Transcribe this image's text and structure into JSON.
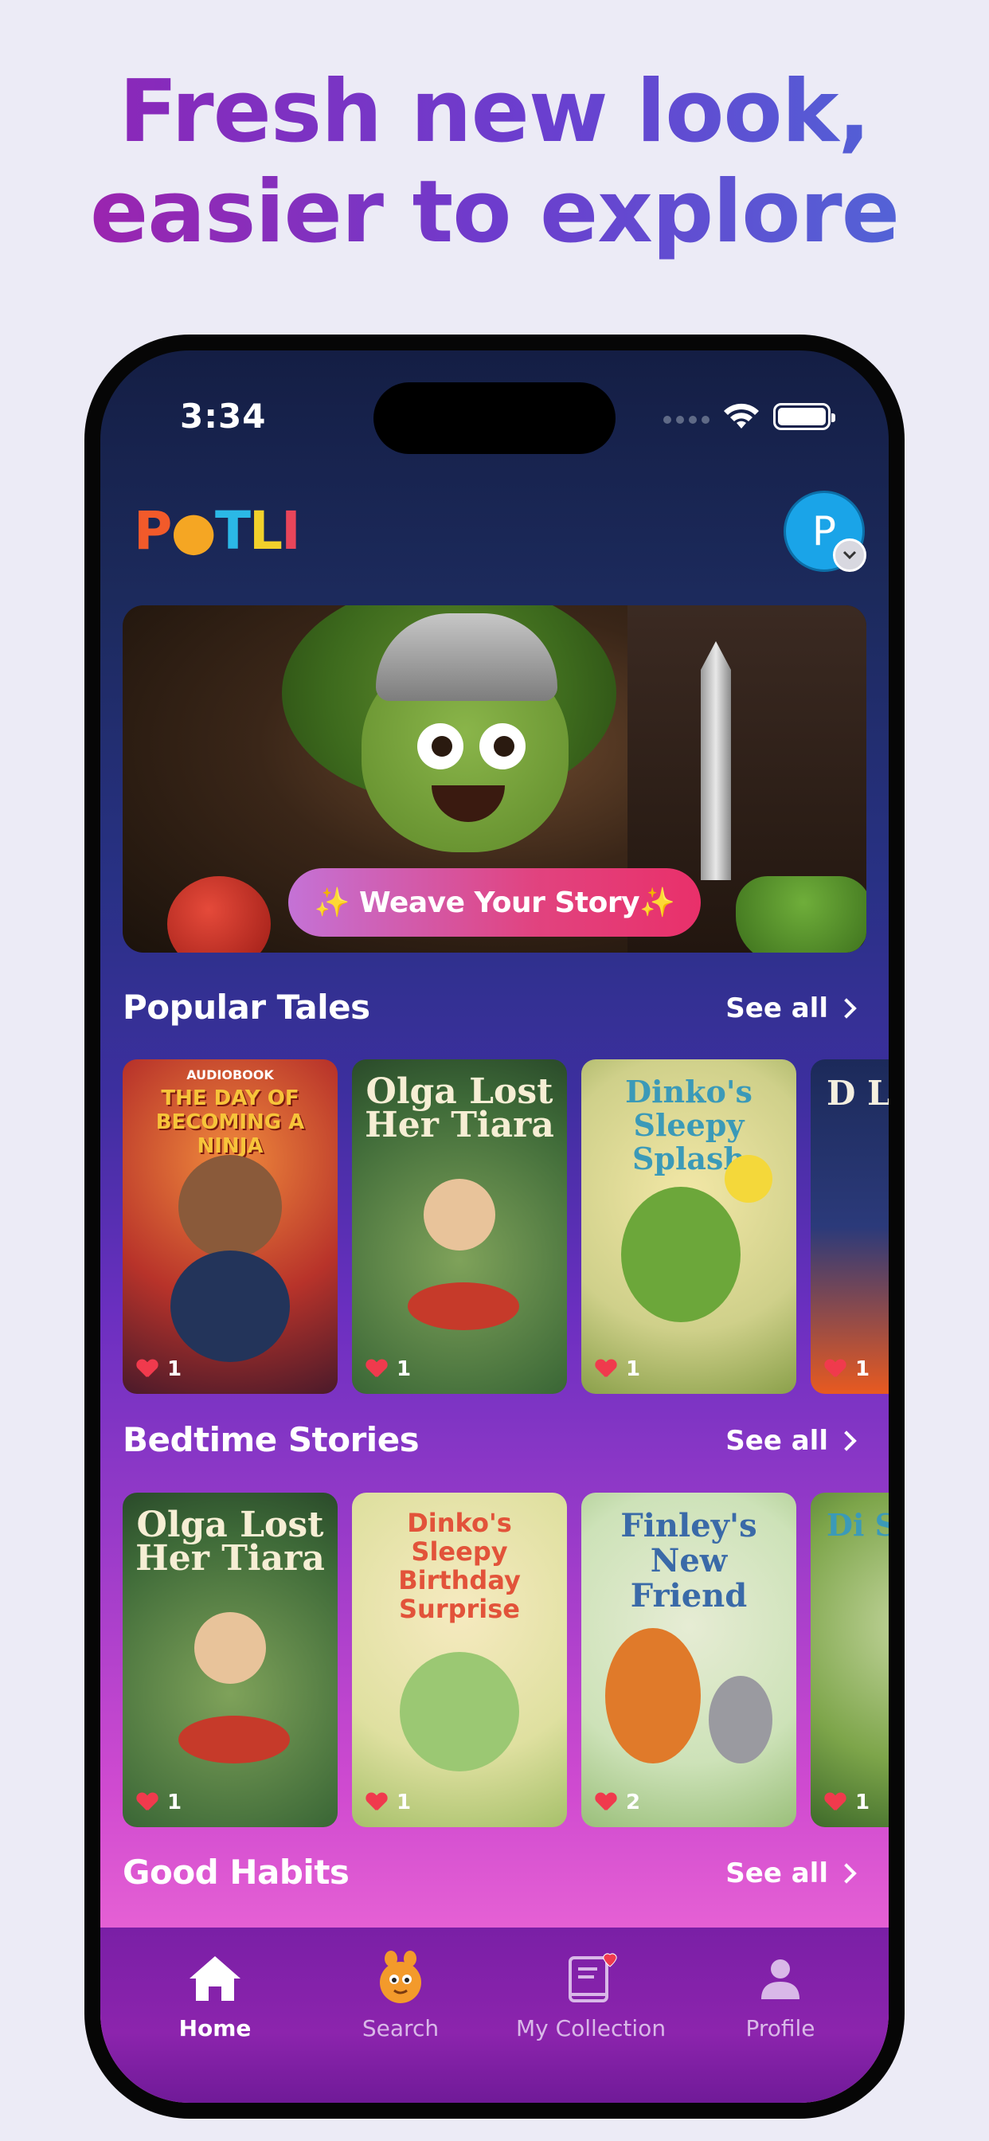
{
  "headline": {
    "line1": "Fresh new look,",
    "line2": "easier to explore"
  },
  "status_bar": {
    "time": "3:34"
  },
  "app": {
    "logo": "POTLI",
    "avatar_initial": "P"
  },
  "hero": {
    "cta_label": "✨ Weave Your Story✨"
  },
  "sections": [
    {
      "title": "Popular Tales",
      "see_all": "See all",
      "cards": [
        {
          "title_top": "AUDIOBOOK",
          "title": "THE DAY OF BECOMING A NINJA",
          "likes": "1"
        },
        {
          "title": "Olga Lost Her Tiara",
          "likes": "1"
        },
        {
          "title": "Dinko's Sleepy Splash",
          "likes": "1"
        },
        {
          "title": "D Lov",
          "likes": "1"
        }
      ]
    },
    {
      "title": "Bedtime Stories",
      "see_all": "See all",
      "cards": [
        {
          "title": "Olga Lost Her Tiara",
          "likes": "1"
        },
        {
          "title": "Dinko's Sleepy Birthday Surprise",
          "likes": "1"
        },
        {
          "title": "Finley's New Friend",
          "likes": "2"
        },
        {
          "title": "Di Slee",
          "likes": "1"
        }
      ]
    },
    {
      "title": "Good Habits",
      "see_all": "See all"
    }
  ],
  "tabbar": {
    "items": [
      {
        "label": "Home",
        "icon": "home-icon",
        "active": true
      },
      {
        "label": "Search",
        "icon": "mascot-search-icon"
      },
      {
        "label": "My Collection",
        "icon": "collection-icon"
      },
      {
        "label": "Profile",
        "icon": "profile-icon"
      }
    ]
  },
  "colors": {
    "accent": "#e9306a",
    "tab_bg": "#8c24ad",
    "avatar": "#1aa4e8"
  }
}
